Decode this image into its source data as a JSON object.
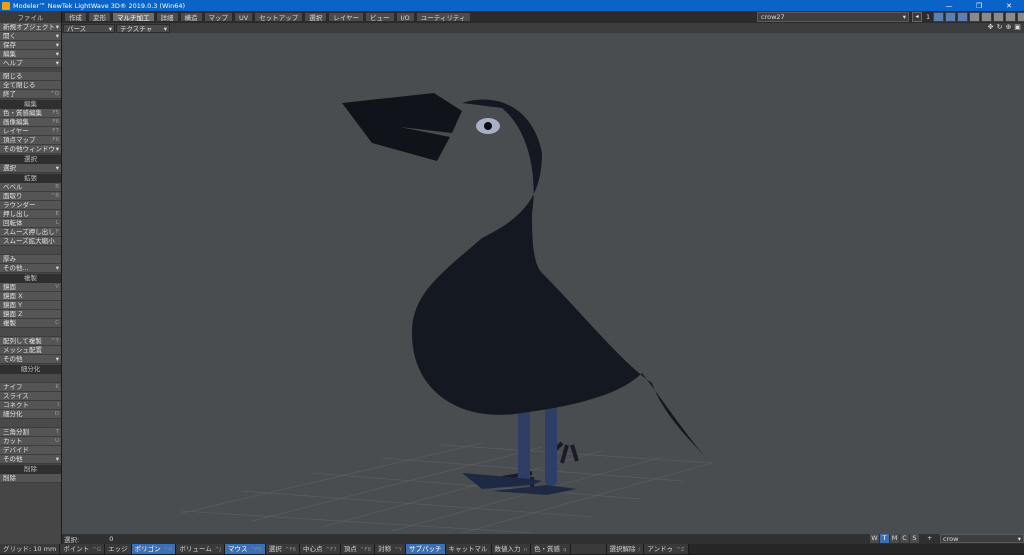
{
  "window": {
    "title": "Modeler™ NewTek LightWave 3D® 2019.0.3 (Win64)",
    "minimize": "—",
    "restore": "❐",
    "close": "✕"
  },
  "menubar": {
    "file_label": "ファイル",
    "tabs": [
      "作成",
      "変形",
      "マルチ加工",
      "詳細",
      "構造",
      "マップ",
      "UV",
      "セットアップ",
      "選択",
      "レイヤー",
      "ビュー",
      "I/O",
      "ユーティリティ"
    ],
    "active_tab": 2,
    "object_name": "crow27",
    "layer_number": "1"
  },
  "sidebar": {
    "file_items": [
      {
        "label": "新規オブジェクト",
        "shortcut": "",
        "dropdown": true
      },
      {
        "label": "開く",
        "dropdown": true
      },
      {
        "label": "保存",
        "dropdown": true
      },
      {
        "label": "編集",
        "dropdown": true
      },
      {
        "label": "ヘルプ",
        "dropdown": true
      }
    ],
    "file_items2": [
      {
        "label": "閉じる",
        "shortcut": ""
      },
      {
        "label": "全て閉じる",
        "shortcut": ""
      },
      {
        "label": "終了",
        "shortcut": "^Q"
      }
    ],
    "edit_head": "編集",
    "edit_items": [
      {
        "label": "色・質感編集",
        "shortcut": "F5"
      },
      {
        "label": "画像編集",
        "shortcut": "F6"
      },
      {
        "label": "レイヤー",
        "shortcut": "F7"
      },
      {
        "label": "頂点マップ",
        "shortcut": "F8"
      },
      {
        "label": "その他ウィンドウ",
        "dropdown": true
      }
    ],
    "select_head": "選択",
    "select_items": [
      {
        "label": "選択",
        "dropdown": true
      }
    ],
    "extend_head": "拡張",
    "extend_items": [
      {
        "label": "ベベル",
        "shortcut": "B"
      },
      {
        "label": "面取り",
        "shortcut": "^B"
      },
      {
        "label": "ラウンダー",
        "shortcut": ""
      },
      {
        "label": "押し出し",
        "shortcut": "E"
      },
      {
        "label": "回転体",
        "shortcut": "L"
      },
      {
        "label": "スムーズ押し出し",
        "shortcut": "F"
      },
      {
        "label": "スムーズ拡大縮小",
        "shortcut": ""
      },
      {
        "label": "",
        "dim": true
      },
      {
        "label": "厚み",
        "shortcut": ""
      },
      {
        "label": "その他...",
        "dropdown": true
      }
    ],
    "duplicate_head": "複製",
    "duplicate_items": [
      {
        "label": "鏡面",
        "shortcut": "V"
      },
      {
        "label": "鏡面 X",
        "shortcut": ""
      },
      {
        "label": "鏡面 Y",
        "shortcut": ""
      },
      {
        "label": "鏡面 Z",
        "shortcut": ""
      },
      {
        "label": "複製",
        "shortcut": "C"
      },
      {
        "label": "",
        "dim": true
      },
      {
        "label": "配列して複製",
        "shortcut": "^Y"
      },
      {
        "label": "メッシュ配置",
        "shortcut": ""
      },
      {
        "label": "その他",
        "dropdown": true
      }
    ],
    "subdiv_head": "細分化",
    "subdiv_items": [
      {
        "label": "",
        "dim": true
      },
      {
        "label": "ナイフ",
        "shortcut": "K"
      },
      {
        "label": "スライス",
        "shortcut": ""
      },
      {
        "label": "コネクト",
        "shortcut": "I"
      },
      {
        "label": "細分化",
        "shortcut": "D"
      },
      {
        "label": "",
        "dim": true
      },
      {
        "label": "三角分割",
        "shortcut": "T"
      },
      {
        "label": "カット",
        "shortcut": "U"
      },
      {
        "label": "デバイド",
        "shortcut": ""
      },
      {
        "label": "その他",
        "dropdown": true
      }
    ],
    "delete_head": "削除",
    "delete_items": [
      {
        "label": "削除",
        "shortcut": ""
      }
    ]
  },
  "viewport": {
    "view_mode": "パース",
    "render_mode": "テクスチャ",
    "nav_icons": [
      "move-icon",
      "rotate-icon",
      "zoom-icon",
      "maximize-icon"
    ]
  },
  "infobar": {
    "label": "選択:",
    "value": "0",
    "modes": [
      "W",
      "T",
      "M",
      "C",
      "S"
    ],
    "active_mode": 1,
    "plus": "+",
    "object": "crow"
  },
  "statusbar": {
    "items": [
      {
        "label": "グリッド:",
        "value": "10 mm"
      },
      {
        "label": "ポイント",
        "sc": "^G"
      },
      {
        "label": "エッジ",
        "sc": ""
      },
      {
        "label": "ポリゴン",
        "sc": "^H",
        "blue": true
      },
      {
        "label": "ボリューム",
        "sc": "^J"
      },
      {
        "label": "マウス",
        "sc": "^F5",
        "blue": true
      },
      {
        "label": "選択",
        "sc": "^F6"
      },
      {
        "label": "中心点",
        "sc": "^F7"
      },
      {
        "label": "頂点",
        "sc": "^F8"
      },
      {
        "label": "対称",
        "sc": "^Y"
      },
      {
        "label": "サブパッチ",
        "sc": "",
        "blue": true
      },
      {
        "label": "キャットマル",
        "sc": ""
      },
      {
        "label": "数値入力",
        "sc": "n"
      },
      {
        "label": "色・質感",
        "sc": "q"
      },
      {
        "label": "",
        "dim": true
      },
      {
        "label": "選択解除",
        "sc": "/"
      },
      {
        "label": "アンドゥ",
        "sc": "^Z"
      }
    ]
  }
}
